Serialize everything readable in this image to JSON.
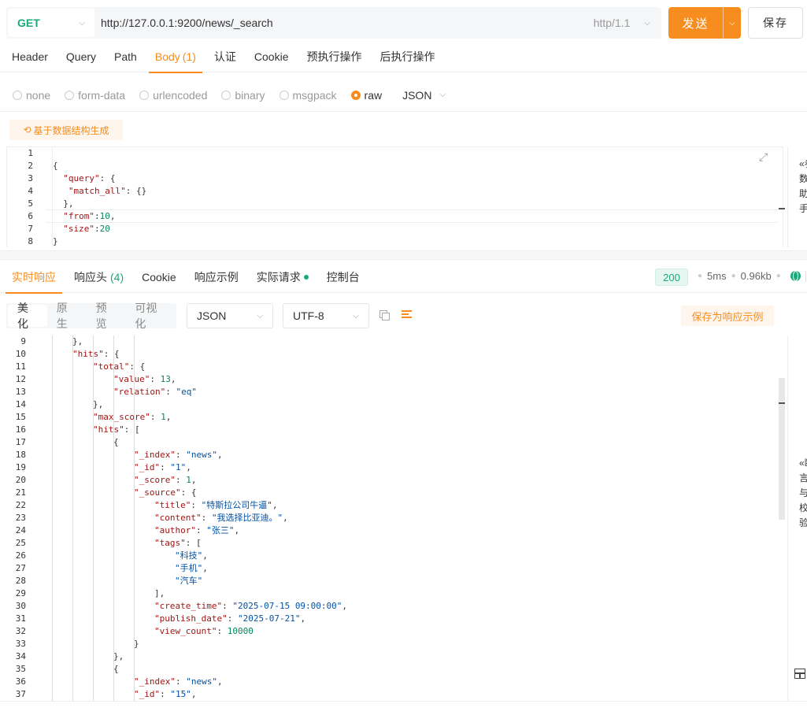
{
  "request": {
    "method": "GET",
    "url": "http://127.0.0.1:9200/news/_search",
    "protocol": "http/1.1",
    "send_label": "发送",
    "save_label": "保存"
  },
  "request_tabs": [
    {
      "label": "Header",
      "count": ""
    },
    {
      "label": "Query",
      "count": ""
    },
    {
      "label": "Path",
      "count": ""
    },
    {
      "label": "Body",
      "count": "(1)"
    },
    {
      "label": "认证",
      "count": ""
    },
    {
      "label": "Cookie",
      "count": ""
    },
    {
      "label": "预执行操作",
      "count": ""
    },
    {
      "label": "后执行操作",
      "count": ""
    }
  ],
  "active_request_tab": "Body",
  "body_types": [
    "none",
    "form-data",
    "urlencoded",
    "binary",
    "msgpack",
    "raw"
  ],
  "selected_body_type": "raw",
  "raw_format": "JSON",
  "generate_button": "基于数据结构生成",
  "request_body_lines": [
    "",
    "{",
    "  \"query\": {",
    "   \"match_all\": {}",
    "  },",
    "  \"from\":10,",
    "  \"size\":20",
    "}"
  ],
  "side_panel_top_text": "«参数助手",
  "response_tabs": [
    {
      "label": "实时响应",
      "count": ""
    },
    {
      "label": "响应头",
      "count": "(4)"
    },
    {
      "label": "Cookie",
      "count": ""
    },
    {
      "label": "响应示例",
      "count": ""
    },
    {
      "label": "实际请求",
      "count": ""
    },
    {
      "label": "控制台",
      "count": ""
    }
  ],
  "active_response_tab": "实时响应",
  "response_status": {
    "code": "200",
    "time": "5ms",
    "size": "0.96kb"
  },
  "view_modes": [
    "美化",
    "原生",
    "预览",
    "可视化"
  ],
  "active_view_mode": "美化",
  "response_format": "JSON",
  "response_encoding": "UTF-8",
  "save_example_label": "保存为响应示例",
  "response_lines": [
    {
      "n": "9",
      "indent": 1,
      "text": "},"
    },
    {
      "n": "10",
      "indent": 1,
      "text": "\"hits\": {"
    },
    {
      "n": "11",
      "indent": 2,
      "text": "\"total\": {"
    },
    {
      "n": "12",
      "indent": 3,
      "text": "\"value\": 13,"
    },
    {
      "n": "13",
      "indent": 3,
      "text": "\"relation\": \"eq\""
    },
    {
      "n": "14",
      "indent": 2,
      "text": "},"
    },
    {
      "n": "15",
      "indent": 2,
      "text": "\"max_score\": 1,"
    },
    {
      "n": "16",
      "indent": 2,
      "text": "\"hits\": ["
    },
    {
      "n": "17",
      "indent": 3,
      "text": "{"
    },
    {
      "n": "18",
      "indent": 4,
      "text": "\"_index\": \"news\","
    },
    {
      "n": "19",
      "indent": 4,
      "text": "\"_id\": \"1\","
    },
    {
      "n": "20",
      "indent": 4,
      "text": "\"_score\": 1,"
    },
    {
      "n": "21",
      "indent": 4,
      "text": "\"_source\": {"
    },
    {
      "n": "22",
      "indent": 5,
      "text": "\"title\": \"特斯拉公司牛逼\","
    },
    {
      "n": "23",
      "indent": 5,
      "text": "\"content\": \"我选择比亚迪。\","
    },
    {
      "n": "24",
      "indent": 5,
      "text": "\"author\": \"张三\","
    },
    {
      "n": "25",
      "indent": 5,
      "text": "\"tags\": ["
    },
    {
      "n": "26",
      "indent": 6,
      "text": "\"科技\","
    },
    {
      "n": "27",
      "indent": 6,
      "text": "\"手机\","
    },
    {
      "n": "28",
      "indent": 6,
      "text": "\"汽车\""
    },
    {
      "n": "29",
      "indent": 5,
      "text": "],"
    },
    {
      "n": "30",
      "indent": 5,
      "text": "\"create_time\": \"2025-07-15 09:00:00\","
    },
    {
      "n": "31",
      "indent": 5,
      "text": "\"publish_date\": \"2025-07-21\","
    },
    {
      "n": "32",
      "indent": 5,
      "text": "\"view_count\": 10000"
    },
    {
      "n": "33",
      "indent": 4,
      "text": "}"
    },
    {
      "n": "34",
      "indent": 3,
      "text": "},"
    },
    {
      "n": "35",
      "indent": 3,
      "text": "{"
    },
    {
      "n": "36",
      "indent": 4,
      "text": "\"_index\": \"news\","
    },
    {
      "n": "37",
      "indent": 4,
      "text": "\"_id\": \"15\","
    }
  ],
  "side_panel_bottom_text": "«断言与校验",
  "colors": {
    "accent": "#f78d1e",
    "method_green": "#19a97b",
    "json_key": "#a31515",
    "json_string": "#0451a5",
    "json_number": "#098658"
  }
}
